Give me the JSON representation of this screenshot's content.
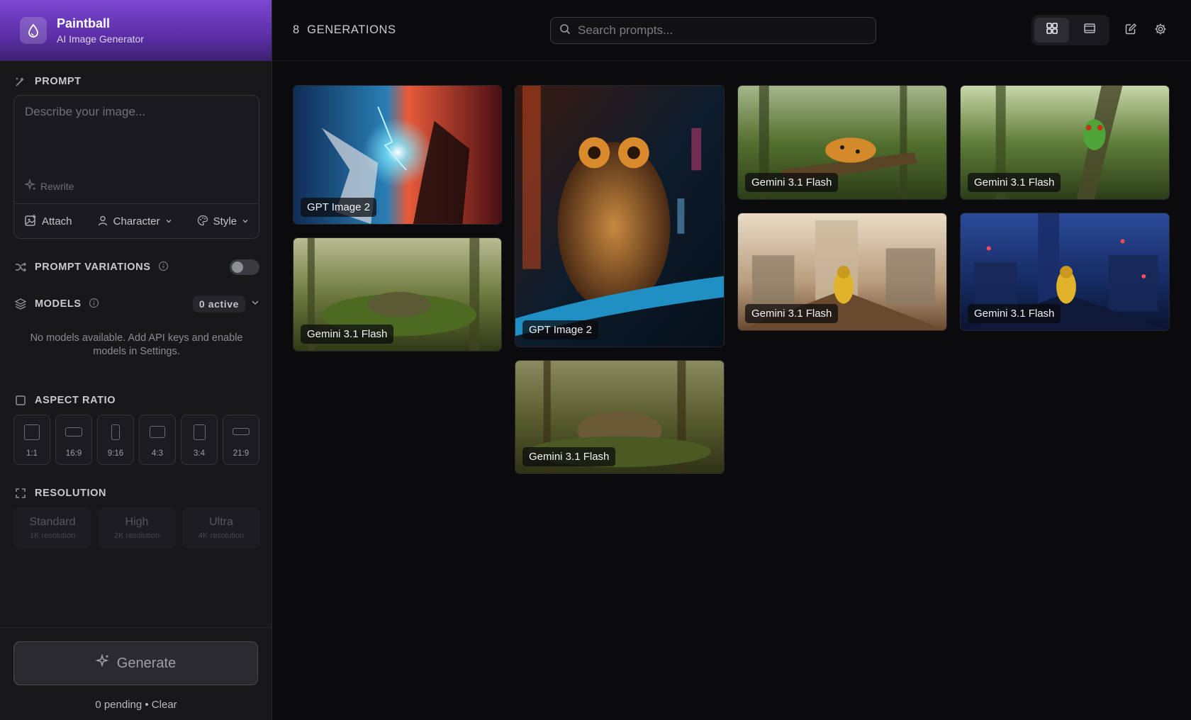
{
  "brand": {
    "title": "Paintball",
    "subtitle": "AI Image Generator"
  },
  "prompt": {
    "heading": "PROMPT",
    "placeholder": "Describe your image...",
    "rewrite": "Rewrite",
    "tools": {
      "attach": "Attach",
      "character": "Character",
      "style": "Style"
    }
  },
  "variations": {
    "heading": "PROMPT VARIATIONS",
    "enabled": false
  },
  "models": {
    "heading": "MODELS",
    "active_badge": "0 active",
    "empty_message": "No models available. Add API keys and enable models in Settings."
  },
  "aspect_ratio": {
    "heading": "ASPECT RATIO",
    "options": [
      "1:1",
      "16:9",
      "9:16",
      "4:3",
      "3:4",
      "21:9"
    ]
  },
  "resolution": {
    "heading": "RESOLUTION",
    "options": [
      {
        "label": "Standard",
        "sub": "1K resolution"
      },
      {
        "label": "High",
        "sub": "2K resolution"
      },
      {
        "label": "Ultra",
        "sub": "4K resolution"
      }
    ]
  },
  "footer": {
    "generate_label": "Generate",
    "pending_text": "0 pending • Clear"
  },
  "header": {
    "generations_count": "8",
    "generations_label": "GENERATIONS",
    "search_placeholder": "Search prompts..."
  },
  "gallery": [
    {
      "model": "GPT Image 2",
      "subject": "wizards battle lightning",
      "palette": [
        "#1b3a6b",
        "#c03a2b",
        "#38c9ef"
      ]
    },
    {
      "model": "Gemini 3.1 Flash",
      "subject": "frog on lily pad in swamp",
      "palette": [
        "#44552b",
        "#7d8a4a",
        "#b3b78a"
      ]
    },
    {
      "model": "GPT Image 2",
      "subject": "steampunk owl neon city",
      "palette": [
        "#0b1b2a",
        "#a86a2e",
        "#2aa7d6"
      ]
    },
    {
      "model": "Gemini 3.1 Flash",
      "subject": "toad in swamp",
      "palette": [
        "#3d4a23",
        "#6a6a3a",
        "#8f8a5e"
      ]
    },
    {
      "model": "Gemini 3.1 Flash",
      "subject": "orange frog on log",
      "palette": [
        "#3f5a2a",
        "#c9822a",
        "#6f8a4a"
      ]
    },
    {
      "model": "Gemini 3.1 Flash",
      "subject": "yellow raincoat figure city",
      "palette": [
        "#d7c3a6",
        "#8a6a4d",
        "#e0b32a"
      ]
    },
    {
      "model": "Gemini 3.1 Flash",
      "subject": "tree frog in swamp",
      "palette": [
        "#3e5a2f",
        "#7ea24e",
        "#c6d7a4"
      ]
    },
    {
      "model": "Gemini 3.1 Flash",
      "subject": "yellow raincoat figure night",
      "palette": [
        "#0f1f4d",
        "#2b4a9a",
        "#e0b32a"
      ]
    }
  ]
}
